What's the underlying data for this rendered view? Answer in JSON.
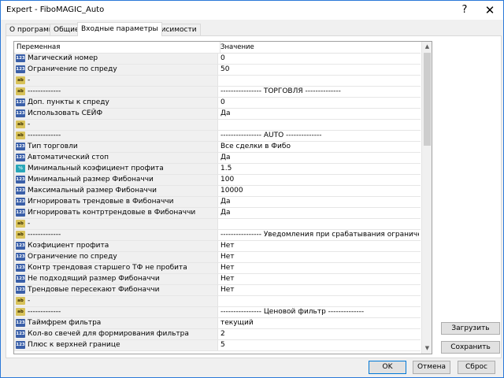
{
  "window": {
    "title": "Expert - FiboMAGIC_Auto",
    "help_glyph": "?",
    "close_glyph": "✕"
  },
  "tabs": [
    {
      "label": "О программе"
    },
    {
      "label": "Общие"
    },
    {
      "label": "Входные параметры"
    },
    {
      "label": "Зависимости"
    }
  ],
  "grid": {
    "col_variable": "Переменная",
    "col_value": "Значение",
    "rows": [
      {
        "type": "int",
        "icon": "123",
        "name": "Магический номер",
        "value": "0"
      },
      {
        "type": "int",
        "icon": "123",
        "name": "Ограничение по спреду",
        "value": "50"
      },
      {
        "type": "str",
        "icon": "ab",
        "name": "-",
        "value": ""
      },
      {
        "type": "str",
        "icon": "ab",
        "name": "-------------",
        "value": "---------------- ТОРГОВЛЯ --------------"
      },
      {
        "type": "int",
        "icon": "123",
        "name": "Доп. пункты к спреду",
        "value": "0"
      },
      {
        "type": "int",
        "icon": "123",
        "name": "Использовать СЕЙФ",
        "value": "Да"
      },
      {
        "type": "str",
        "icon": "ab",
        "name": "-",
        "value": ""
      },
      {
        "type": "str",
        "icon": "ab",
        "name": "-------------",
        "value": "---------------- AUTO --------------"
      },
      {
        "type": "int",
        "icon": "123",
        "name": "Тип торговли",
        "value": "Все сделки в Фибо"
      },
      {
        "type": "int",
        "icon": "123",
        "name": "Автоматический стоп",
        "value": "Да"
      },
      {
        "type": "dbl",
        "icon": "½",
        "name": "Минимальный коэфициент профита",
        "value": "1.5"
      },
      {
        "type": "int",
        "icon": "123",
        "name": "Минимальный размер Фибоначчи",
        "value": "100"
      },
      {
        "type": "int",
        "icon": "123",
        "name": "Максимальный размер Фибоначчи",
        "value": "10000"
      },
      {
        "type": "int",
        "icon": "123",
        "name": "Игнорировать трендовые в Фибоначчи",
        "value": "Да"
      },
      {
        "type": "int",
        "icon": "123",
        "name": "Игнорировать контртрендовые в Фибоначчи",
        "value": "Да"
      },
      {
        "type": "str",
        "icon": "ab",
        "name": "-",
        "value": ""
      },
      {
        "type": "str",
        "icon": "ab",
        "name": "-------------",
        "value": "---------------- Уведомления при срабатывания ограничений на откры..."
      },
      {
        "type": "int",
        "icon": "123",
        "name": "Коэфициент профита",
        "value": "Нет"
      },
      {
        "type": "int",
        "icon": "123",
        "name": "Ограничение по спреду",
        "value": "Нет"
      },
      {
        "type": "int",
        "icon": "123",
        "name": "Контр трендовая старшего ТФ не пробита",
        "value": "Нет"
      },
      {
        "type": "int",
        "icon": "123",
        "name": "Не подходящий размер Фибоначчи",
        "value": "Нет"
      },
      {
        "type": "int",
        "icon": "123",
        "name": "Трендовые пересекают Фибоначчи",
        "value": "Нет"
      },
      {
        "type": "str",
        "icon": "ab",
        "name": "-",
        "value": ""
      },
      {
        "type": "str",
        "icon": "ab",
        "name": "-------------",
        "value": "---------------- Ценовой фильтр --------------"
      },
      {
        "type": "int",
        "icon": "123",
        "name": "Таймфрем фильтра",
        "value": "текущий"
      },
      {
        "type": "int",
        "icon": "123",
        "name": "Кол-во свечей для формирования фильтра",
        "value": "2"
      },
      {
        "type": "int",
        "icon": "123",
        "name": "Плюс к верхней границе",
        "value": "5"
      }
    ]
  },
  "buttons": {
    "load": "Загрузить",
    "save": "Сохранить",
    "ok": "OK",
    "cancel": "Отмена",
    "reset": "Сброс"
  },
  "scrollbar": {
    "up_glyph": "▲",
    "down_glyph": "▼"
  },
  "colors": {
    "window_border": "#2b79d8",
    "ok_border": "#0078d7",
    "int_icon": "#3a5fa8",
    "str_icon": "#d8c25a",
    "double_icon": "#2aa7b8"
  }
}
